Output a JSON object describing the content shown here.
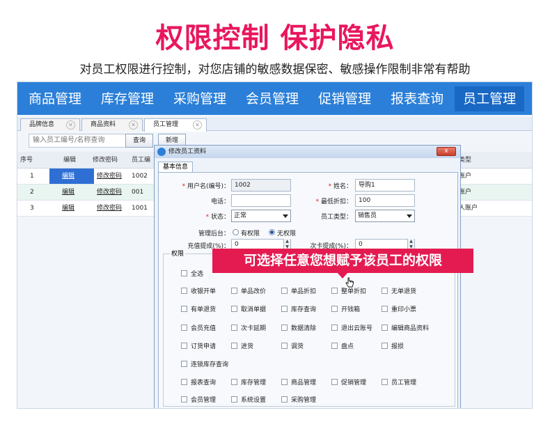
{
  "headline": "权限控制 保护隐私",
  "subline": "对员工权限进行控制，对您店铺的敏感数据保密、敏感操作限制非常有帮助",
  "nav": [
    "商品管理",
    "库存管理",
    "采购管理",
    "会员管理",
    "促销管理",
    "报表查询",
    "员工管理"
  ],
  "nav_active": "员工管理",
  "tabs": [
    "品牌信息",
    "商品资料",
    "员工管理"
  ],
  "toolbar": {
    "search_placeholder": "输入员工编号/名称查询",
    "query_button": "查询",
    "add_button": "新增"
  },
  "grid": {
    "headers": [
      "序号",
      "编辑",
      "修改密码",
      "员工编",
      "类型"
    ],
    "rows": [
      {
        "no": "1",
        "edit": "编辑",
        "pwd": "修改密码",
        "id": "1002",
        "type": "账户"
      },
      {
        "no": "2",
        "edit": "编辑",
        "pwd": "修改密码",
        "id": "001",
        "type": "账户"
      },
      {
        "no": "3",
        "edit": "编辑",
        "pwd": "修改密码",
        "id": "1001",
        "type": "人账户"
      }
    ]
  },
  "dialog": {
    "title": "修改员工资料",
    "close": "x",
    "tab": "基本信息",
    "user_label": "用户名(编号)：",
    "user_value": "1002",
    "name_label": "姓名：",
    "name_value": "导购1",
    "phone_label": "电话：",
    "phone_value": "",
    "discount_label": "最低折扣：",
    "discount_value": "100",
    "status_label": "状态：",
    "status_value": "正常",
    "type_label": "员工类型：",
    "type_value": "销售员",
    "backend_label": "管理后台：",
    "backend_opt_yes": "有权限",
    "backend_opt_no": "无权限",
    "backend_selected": "无权限",
    "recharge_label": "充值提成(%)：",
    "recharge_value": "0",
    "card_label": "次卡提成(%)：",
    "card_value": "0",
    "perm_legend": "权限",
    "perm_all": "全选",
    "permissions": [
      [
        "收银开单",
        "单品改价",
        "单品折扣",
        "整单折扣",
        "无单退货"
      ],
      [
        "有单退货",
        "取消单据",
        "库存查询",
        "开钱箱",
        "重印小票"
      ],
      [
        "会员充值",
        "次卡延期",
        "数据清除",
        "退出云账号",
        "编辑商品资料"
      ],
      [
        "订货申请",
        "进货",
        "调货",
        "盘点",
        "报损"
      ],
      [
        "连锁库存查询"
      ],
      [
        "报表查询",
        "库存管理",
        "商品管理",
        "促销管理",
        "员工管理"
      ],
      [
        "会员管理",
        "系统设置",
        "采购管理"
      ]
    ]
  },
  "banner": "可选择任意您想赋予该员工的权限",
  "colors": {
    "brand_pink": "#e8175d",
    "nav_blue": "#2b7fd8",
    "banner_red": "#e41b51"
  },
  "icons": [
    "tab-close-icon",
    "dialog-logo-icon",
    "dialog-close-icon",
    "dropdown-arrow-icon",
    "cursor-pointer-icon"
  ]
}
